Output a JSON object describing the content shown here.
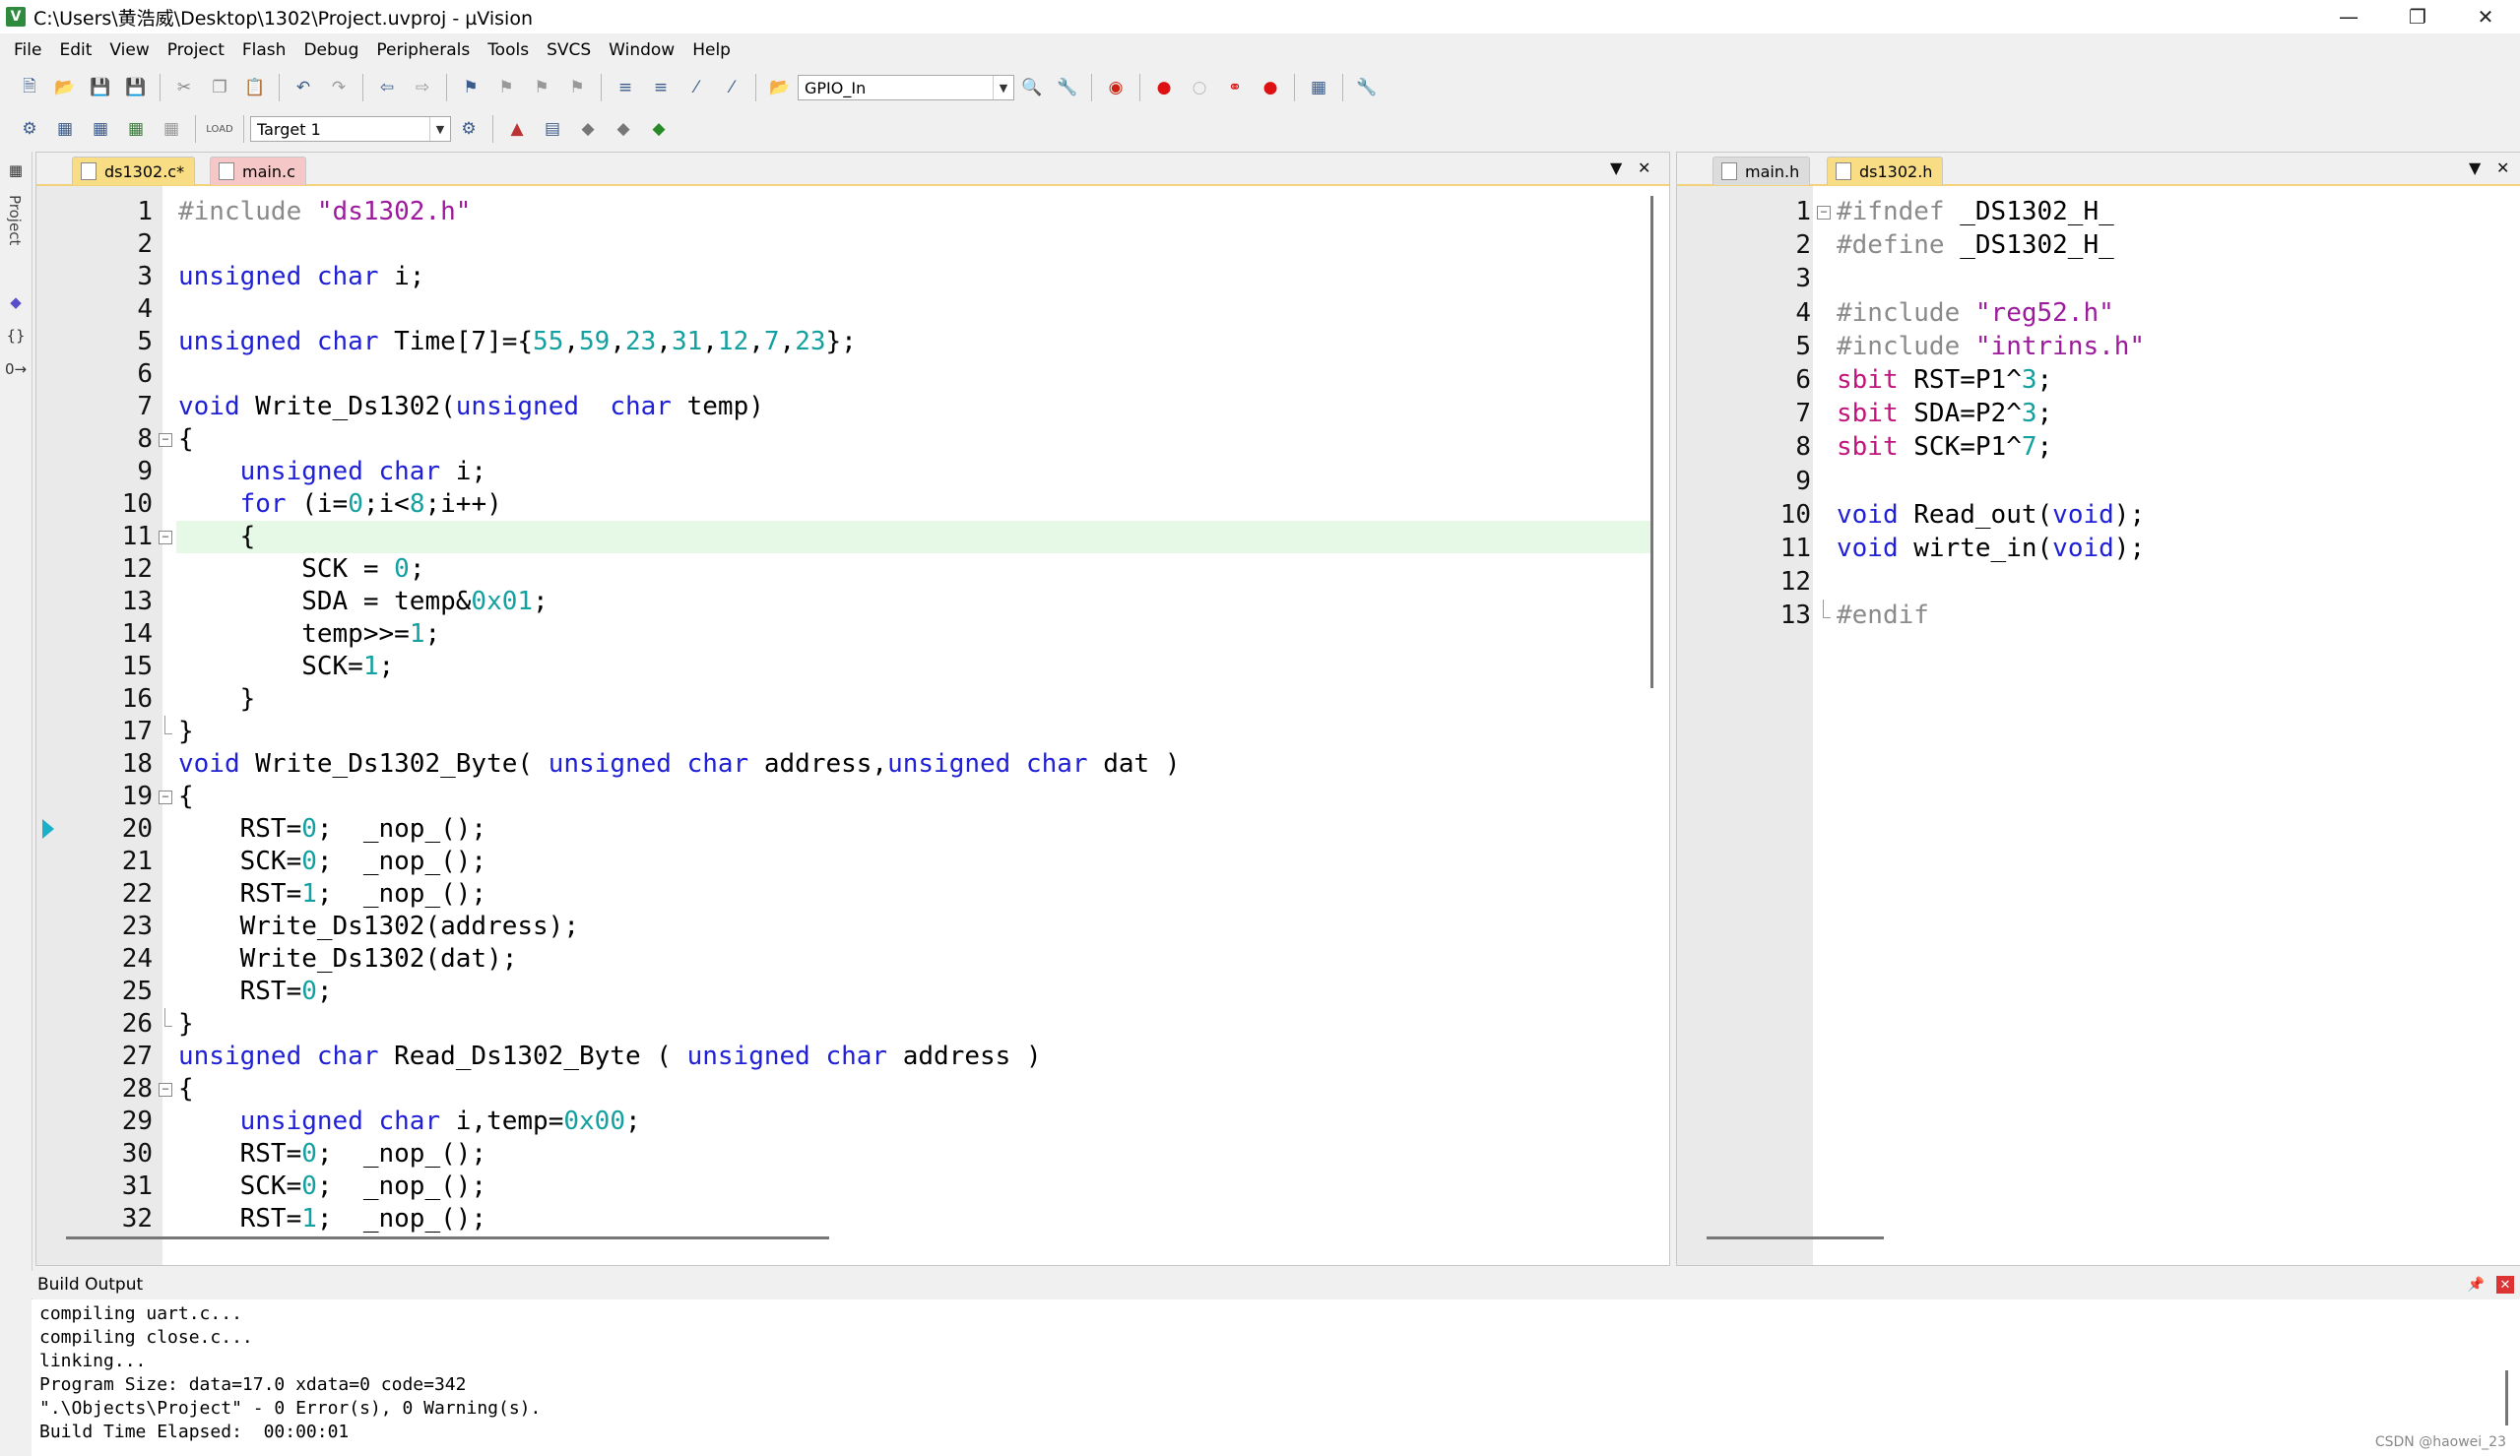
{
  "window": {
    "title": "C:\\Users\\黄浩威\\Desktop\\1302\\Project.uvproj - µVision",
    "minimize_icon": "minimize-icon",
    "restore_icon": "restore-icon",
    "close_icon": "close-icon"
  },
  "menu": [
    "File",
    "Edit",
    "View",
    "Project",
    "Flash",
    "Debug",
    "Peripherals",
    "Tools",
    "SVCS",
    "Window",
    "Help"
  ],
  "toolbar": {
    "target_combo": "GPIO_In",
    "build_target": "Target 1"
  },
  "left_strip": {
    "label": "Project"
  },
  "left_editor": {
    "tabs": [
      {
        "label": "ds1302.c*",
        "state": "active"
      },
      {
        "label": "main.c",
        "state": "pink"
      }
    ],
    "lines": [
      {
        "n": "1",
        "code": [
          {
            "t": "#include ",
            "c": "pp"
          },
          {
            "t": "\"ds1302.h\"",
            "c": "str"
          }
        ]
      },
      {
        "n": "2",
        "code": []
      },
      {
        "n": "3",
        "code": [
          {
            "t": "unsigned char",
            "c": "kw"
          },
          {
            "t": " i;",
            "c": ""
          }
        ]
      },
      {
        "n": "4",
        "code": []
      },
      {
        "n": "5",
        "code": [
          {
            "t": "unsigned char",
            "c": "kw"
          },
          {
            "t": " Time[7]={",
            "c": ""
          },
          {
            "t": "55",
            "c": "num"
          },
          {
            "t": ",",
            "c": ""
          },
          {
            "t": "59",
            "c": "num"
          },
          {
            "t": ",",
            "c": ""
          },
          {
            "t": "23",
            "c": "num"
          },
          {
            "t": ",",
            "c": ""
          },
          {
            "t": "31",
            "c": "num"
          },
          {
            "t": ",",
            "c": ""
          },
          {
            "t": "12",
            "c": "num"
          },
          {
            "t": ",",
            "c": ""
          },
          {
            "t": "7",
            "c": "num"
          },
          {
            "t": ",",
            "c": ""
          },
          {
            "t": "23",
            "c": "num"
          },
          {
            "t": "};",
            "c": ""
          }
        ]
      },
      {
        "n": "6",
        "code": []
      },
      {
        "n": "7",
        "code": [
          {
            "t": "void",
            "c": "kw"
          },
          {
            "t": " Write_Ds1302(",
            "c": ""
          },
          {
            "t": "unsigned",
            "c": "kw"
          },
          {
            "t": "  ",
            "c": ""
          },
          {
            "t": "char",
            "c": "kw"
          },
          {
            "t": " temp)",
            "c": ""
          }
        ]
      },
      {
        "n": "8",
        "code": [
          {
            "t": "{",
            "c": ""
          }
        ],
        "fold": "open"
      },
      {
        "n": "9",
        "code": [
          {
            "t": "    ",
            "c": ""
          },
          {
            "t": "unsigned char",
            "c": "kw"
          },
          {
            "t": " i;",
            "c": ""
          }
        ]
      },
      {
        "n": "10",
        "code": [
          {
            "t": "    ",
            "c": ""
          },
          {
            "t": "for",
            "c": "kw"
          },
          {
            "t": " (i=",
            "c": ""
          },
          {
            "t": "0",
            "c": "num"
          },
          {
            "t": ";i<",
            "c": ""
          },
          {
            "t": "8",
            "c": "num"
          },
          {
            "t": ";i++)",
            "c": ""
          }
        ]
      },
      {
        "n": "11",
        "code": [
          {
            "t": "    {",
            "c": ""
          }
        ],
        "fold": "open",
        "highlight": true
      },
      {
        "n": "12",
        "code": [
          {
            "t": "        SCK = ",
            "c": ""
          },
          {
            "t": "0",
            "c": "num"
          },
          {
            "t": ";",
            "c": ""
          }
        ]
      },
      {
        "n": "13",
        "code": [
          {
            "t": "        SDA = temp&",
            "c": ""
          },
          {
            "t": "0x01",
            "c": "num"
          },
          {
            "t": ";",
            "c": ""
          }
        ]
      },
      {
        "n": "14",
        "code": [
          {
            "t": "        temp>>=",
            "c": ""
          },
          {
            "t": "1",
            "c": "num"
          },
          {
            "t": ";",
            "c": ""
          }
        ]
      },
      {
        "n": "15",
        "code": [
          {
            "t": "        SCK=",
            "c": ""
          },
          {
            "t": "1",
            "c": "num"
          },
          {
            "t": ";",
            "c": ""
          }
        ]
      },
      {
        "n": "16",
        "code": [
          {
            "t": "    }",
            "c": ""
          }
        ]
      },
      {
        "n": "17",
        "code": [
          {
            "t": "}",
            "c": ""
          }
        ],
        "fold": "end"
      },
      {
        "n": "18",
        "code": [
          {
            "t": "void",
            "c": "kw"
          },
          {
            "t": " Write_Ds1302_Byte( ",
            "c": ""
          },
          {
            "t": "unsigned char",
            "c": "kw"
          },
          {
            "t": " address,",
            "c": ""
          },
          {
            "t": "unsigned char",
            "c": "kw"
          },
          {
            "t": " dat )",
            "c": ""
          }
        ]
      },
      {
        "n": "19",
        "code": [
          {
            "t": "{",
            "c": ""
          }
        ],
        "fold": "open"
      },
      {
        "n": "20",
        "code": [
          {
            "t": "    RST=",
            "c": ""
          },
          {
            "t": "0",
            "c": "num"
          },
          {
            "t": ";  _nop_();",
            "c": ""
          }
        ],
        "marker": true
      },
      {
        "n": "21",
        "code": [
          {
            "t": "    SCK=",
            "c": ""
          },
          {
            "t": "0",
            "c": "num"
          },
          {
            "t": ";  _nop_();",
            "c": ""
          }
        ]
      },
      {
        "n": "22",
        "code": [
          {
            "t": "    RST=",
            "c": ""
          },
          {
            "t": "1",
            "c": "num"
          },
          {
            "t": ";  _nop_();",
            "c": ""
          }
        ]
      },
      {
        "n": "23",
        "code": [
          {
            "t": "    Write_Ds1302(address);",
            "c": ""
          }
        ]
      },
      {
        "n": "24",
        "code": [
          {
            "t": "    Write_Ds1302(dat);",
            "c": ""
          }
        ]
      },
      {
        "n": "25",
        "code": [
          {
            "t": "    RST=",
            "c": ""
          },
          {
            "t": "0",
            "c": "num"
          },
          {
            "t": ";",
            "c": ""
          }
        ]
      },
      {
        "n": "26",
        "code": [
          {
            "t": "}",
            "c": ""
          }
        ],
        "fold": "end"
      },
      {
        "n": "27",
        "code": [
          {
            "t": "unsigned char",
            "c": "kw"
          },
          {
            "t": " Read_Ds1302_Byte ( ",
            "c": ""
          },
          {
            "t": "unsigned char",
            "c": "kw"
          },
          {
            "t": " address )",
            "c": ""
          }
        ]
      },
      {
        "n": "28",
        "code": [
          {
            "t": "{",
            "c": ""
          }
        ],
        "fold": "open"
      },
      {
        "n": "29",
        "code": [
          {
            "t": "    ",
            "c": ""
          },
          {
            "t": "unsigned char",
            "c": "kw"
          },
          {
            "t": " i,temp=",
            "c": ""
          },
          {
            "t": "0x00",
            "c": "num"
          },
          {
            "t": ";",
            "c": ""
          }
        ]
      },
      {
        "n": "30",
        "code": [
          {
            "t": "    RST=",
            "c": ""
          },
          {
            "t": "0",
            "c": "num"
          },
          {
            "t": ";  _nop_();",
            "c": ""
          }
        ]
      },
      {
        "n": "31",
        "code": [
          {
            "t": "    SCK=",
            "c": ""
          },
          {
            "t": "0",
            "c": "num"
          },
          {
            "t": ";  _nop_();",
            "c": ""
          }
        ]
      },
      {
        "n": "32",
        "code": [
          {
            "t": "    RST=",
            "c": ""
          },
          {
            "t": "1",
            "c": "num"
          },
          {
            "t": ";  _nop_();",
            "c": ""
          }
        ]
      }
    ]
  },
  "right_editor": {
    "tabs": [
      {
        "label": "main.h",
        "state": "inactive"
      },
      {
        "label": "ds1302.h",
        "state": "active"
      }
    ],
    "lines": [
      {
        "n": "1",
        "code": [
          {
            "t": "#ifndef ",
            "c": "pp"
          },
          {
            "t": "_DS1302_H_",
            "c": ""
          }
        ],
        "fold": "open"
      },
      {
        "n": "2",
        "code": [
          {
            "t": "#define ",
            "c": "pp"
          },
          {
            "t": "_DS1302_H_",
            "c": ""
          }
        ]
      },
      {
        "n": "3",
        "code": []
      },
      {
        "n": "4",
        "code": [
          {
            "t": "#include ",
            "c": "pp"
          },
          {
            "t": "\"reg52.h\"",
            "c": "str"
          }
        ]
      },
      {
        "n": "5",
        "code": [
          {
            "t": "#include ",
            "c": "pp"
          },
          {
            "t": "\"intrins.h\"",
            "c": "str"
          }
        ]
      },
      {
        "n": "6",
        "code": [
          {
            "t": "sbit",
            "c": "sbit"
          },
          {
            "t": " RST=P1^",
            "c": ""
          },
          {
            "t": "3",
            "c": "num"
          },
          {
            "t": ";",
            "c": ""
          }
        ]
      },
      {
        "n": "7",
        "code": [
          {
            "t": "sbit",
            "c": "sbit"
          },
          {
            "t": " SDA=P2^",
            "c": ""
          },
          {
            "t": "3",
            "c": "num"
          },
          {
            "t": ";",
            "c": ""
          }
        ]
      },
      {
        "n": "8",
        "code": [
          {
            "t": "sbit",
            "c": "sbit"
          },
          {
            "t": " SCK=P1^",
            "c": ""
          },
          {
            "t": "7",
            "c": "num"
          },
          {
            "t": ";",
            "c": ""
          }
        ]
      },
      {
        "n": "9",
        "code": []
      },
      {
        "n": "10",
        "code": [
          {
            "t": "void",
            "c": "kw"
          },
          {
            "t": " Read_out(",
            "c": ""
          },
          {
            "t": "void",
            "c": "kw"
          },
          {
            "t": ");",
            "c": ""
          }
        ]
      },
      {
        "n": "11",
        "code": [
          {
            "t": "void",
            "c": "kw"
          },
          {
            "t": " wirte_in(",
            "c": ""
          },
          {
            "t": "void",
            "c": "kw"
          },
          {
            "t": ");",
            "c": ""
          }
        ]
      },
      {
        "n": "12",
        "code": []
      },
      {
        "n": "13",
        "code": [
          {
            "t": "#endif",
            "c": "pp"
          }
        ],
        "fold": "end"
      }
    ]
  },
  "build_output": {
    "title": "Build Output",
    "lines": [
      "compiling uart.c...",
      "compiling close.c...",
      "linking...",
      "Program Size: data=17.0 xdata=0 code=342",
      "\".\\Objects\\Project\" - 0 Error(s), 0 Warning(s).",
      "Build Time Elapsed:  00:00:01"
    ]
  },
  "watermark": "CSDN @haowei_23"
}
